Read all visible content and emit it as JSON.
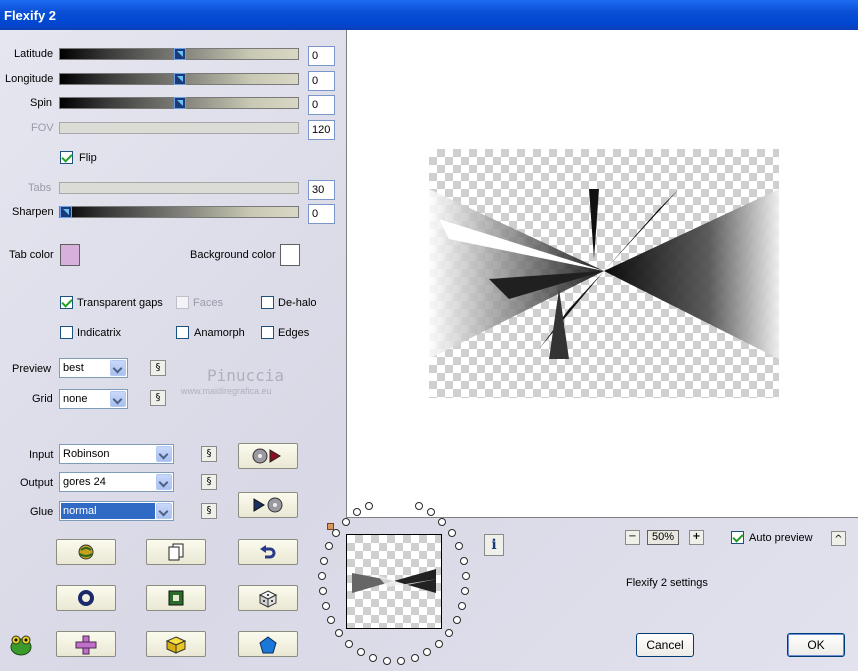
{
  "window": {
    "title": "Flexify 2"
  },
  "sliders": [
    {
      "label": "Latitude",
      "value": "0",
      "level": 0.5,
      "enabled": true
    },
    {
      "label": "Longitude",
      "value": "0",
      "level": 0.5,
      "enabled": true
    },
    {
      "label": "Spin",
      "value": "0",
      "level": 0.5,
      "enabled": true
    },
    {
      "label": "FOV",
      "value": "120",
      "enabled": false
    },
    {
      "label": "Tabs",
      "value": "30",
      "enabled": false
    },
    {
      "label": "Sharpen",
      "value": "0",
      "level": 0.0,
      "enabled": true
    }
  ],
  "flip": {
    "label": "Flip",
    "checked": true
  },
  "colors": {
    "tab_color_label": "Tab color",
    "tab_color": "#d8b0dc",
    "background_color_label": "Background color",
    "background_color": "#ffffff"
  },
  "options": {
    "transparent_gaps": {
      "label": "Transparent gaps",
      "checked": true
    },
    "faces": {
      "label": "Faces",
      "checked": false,
      "enabled": false
    },
    "de_halo": {
      "label": "De-halo",
      "checked": false
    },
    "indicatrix": {
      "label": "Indicatrix",
      "checked": false
    },
    "anamorph": {
      "label": "Anamorph",
      "checked": false
    },
    "edges": {
      "label": "Edges",
      "checked": false
    }
  },
  "dropdowns": {
    "preview": {
      "label": "Preview",
      "value": "best"
    },
    "grid": {
      "label": "Grid",
      "value": "none"
    },
    "input": {
      "label": "Input",
      "value": "Robinson"
    },
    "output": {
      "label": "Output",
      "value": "gores 24"
    },
    "glue": {
      "label": "Glue",
      "value": "normal"
    }
  },
  "small_button_glyph": "§",
  "watermark": {
    "name": "Pinuccia",
    "site": "www.maidiregrafica.eu"
  },
  "zoom": {
    "level": "50%",
    "minus": "−",
    "plus": "+"
  },
  "auto_preview": {
    "label": "Auto preview",
    "checked": true
  },
  "settings_name": "Flexify 2 settings",
  "buttons": {
    "cancel": "Cancel",
    "ok": "OK",
    "info": "i",
    "collapse": "^"
  }
}
